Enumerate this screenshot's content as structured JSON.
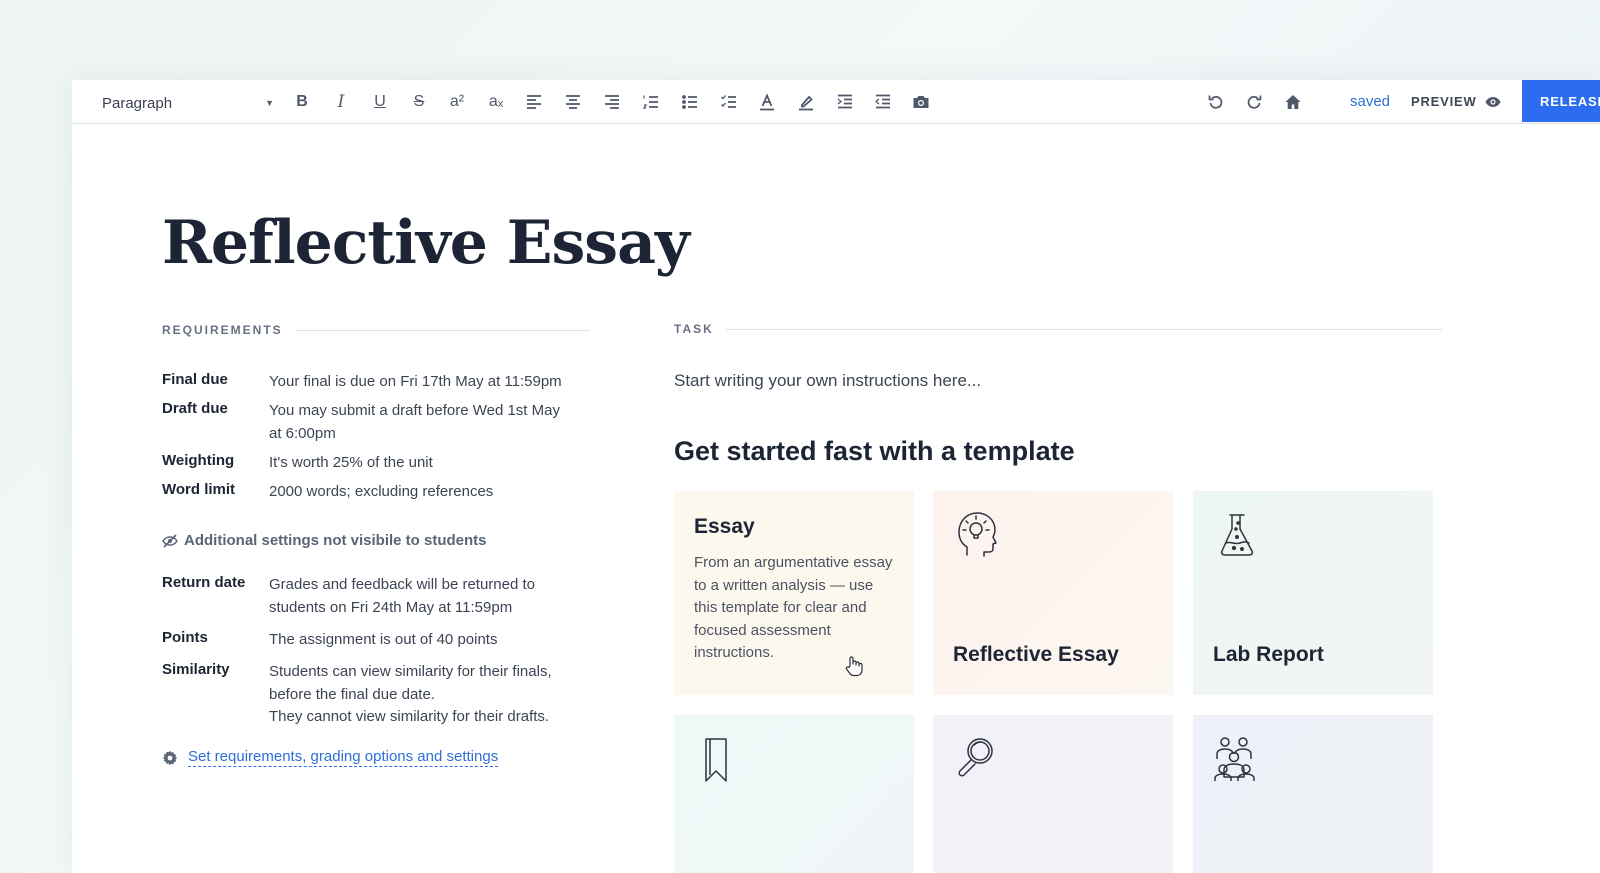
{
  "toolbar": {
    "block_format": "Paragraph",
    "saved_label": "saved",
    "preview_label": "PREVIEW",
    "release_label": "RELEASE",
    "buttons": [
      "bold",
      "italic",
      "underline",
      "strikethrough",
      "superscript",
      "subscript",
      "align-left",
      "align-center",
      "align-right",
      "ordered-list",
      "bullet-list",
      "checklist",
      "text-color",
      "highlight",
      "indent",
      "outdent",
      "insert-image",
      "undo",
      "redo",
      "home"
    ]
  },
  "document": {
    "title": "Reflective Essay"
  },
  "requirements": {
    "label": "REQUIREMENTS",
    "rows": [
      {
        "key": "Final due",
        "value": [
          "Your final is due on Fri 17th May at 11:59pm"
        ]
      },
      {
        "key": "Draft due",
        "value": [
          "You may submit a draft before Wed 1st May",
          "at 6:00pm"
        ]
      },
      {
        "key": "Weighting",
        "value": [
          "It's worth 25% of the unit"
        ]
      },
      {
        "key": "Word limit",
        "value": [
          "2000 words; excluding references"
        ]
      }
    ],
    "hidden_note": "Additional settings not visibile to students",
    "hidden_rows": [
      {
        "key": "Return date",
        "value": [
          "Grades and feedback will be returned to",
          "students on Fri 24th May at 11:59pm"
        ]
      },
      {
        "key": "Points",
        "value": [
          "The assignment is out of 40 points"
        ]
      },
      {
        "key": "Similarity",
        "value": [
          "Students can view similarity for their finals,",
          "before the final due date.",
          "They cannot view similarity for their drafts."
        ]
      }
    ],
    "settings_link": "Set requirements, grading options and settings"
  },
  "task": {
    "label": "TASK",
    "placeholder": "Start writing your own instructions here...",
    "template_heading": "Get started fast with a template"
  },
  "templates": [
    {
      "title": "Essay",
      "description": "From an argumentative essay to a written analysis — use this template for clear and focused assessment instructions.",
      "icon": "none",
      "bg": "#fdf8ee"
    },
    {
      "title": "Reflective Essay",
      "icon": "head-lightbulb-icon",
      "bg": "#fdf3ee"
    },
    {
      "title": "Lab Report",
      "icon": "flask-icon",
      "bg": "#eef5f1"
    },
    {
      "title": "",
      "icon": "bookmark-icon",
      "bg": "#eef7f7"
    },
    {
      "title": "",
      "icon": "magnifier-icon",
      "bg": "#f1f0f8"
    },
    {
      "title": "",
      "icon": "group-icon",
      "bg": "#eef1f7"
    }
  ],
  "colors": {
    "accent": "#2b6cf0",
    "link": "#2e6fd8",
    "text": "#1d2535"
  }
}
